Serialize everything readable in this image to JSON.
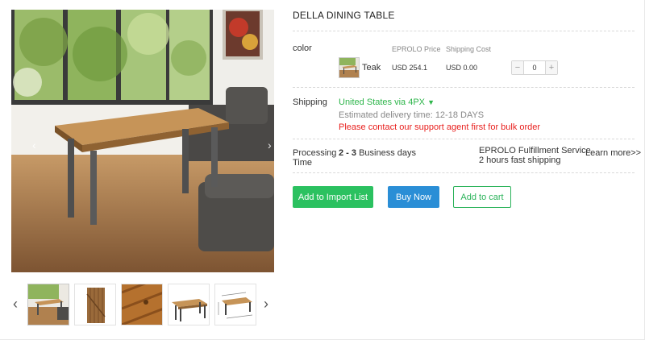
{
  "product": {
    "title": "DELLA DINING TABLE"
  },
  "gallery": {
    "main_image": "dining-table-room-photo",
    "thumbnails": [
      {
        "name": "thumb-room-photo",
        "active": true
      },
      {
        "name": "thumb-wood-panel"
      },
      {
        "name": "thumb-wood-closeup"
      },
      {
        "name": "thumb-table-white"
      },
      {
        "name": "thumb-dimensions"
      }
    ],
    "prev_arrow": "‹",
    "next_arrow": "›"
  },
  "variants": {
    "label": "color",
    "price_header": "EPROLO Price",
    "shipping_header": "Shipping Cost",
    "items": [
      {
        "name": "Teak",
        "price": "USD 254.1",
        "shipping": "USD 0.00",
        "quantity": "0"
      }
    ],
    "minus": "−",
    "plus": "+"
  },
  "shipping": {
    "label": "Shipping",
    "method": "United States via 4PX",
    "caret": "▼",
    "delivery": "Estimated delivery time: 12-18 DAYS",
    "notice": "Please contact our support agent first for bulk order"
  },
  "processing": {
    "label_line1": "Processing",
    "label_line2": "Time",
    "range": "2 - 3",
    "unit": "Business days",
    "service_line1": "EPROLO Fulfillment Service",
    "service_line2": "2 hours fast shipping",
    "learn_more": "Learn more>>"
  },
  "actions": {
    "import": "Add to Import List",
    "buy": "Buy Now",
    "cart": "Add to cart"
  },
  "colors": {
    "green": "#2bc160",
    "blue": "#2a8ed6",
    "red": "#e8201e"
  }
}
